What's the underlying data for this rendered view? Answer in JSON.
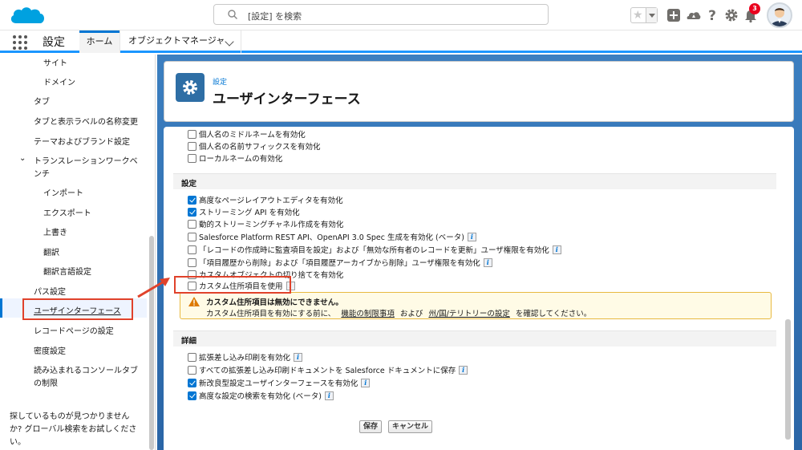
{
  "header": {
    "search_placeholder": "[設定] を検索",
    "notification_count": "3"
  },
  "context_bar": {
    "app_name": "設定",
    "tabs": [
      {
        "label": "ホーム"
      },
      {
        "label": "オブジェクトマネージャ"
      }
    ]
  },
  "sidebar": {
    "items": [
      {
        "label": "サイト"
      },
      {
        "label": "ドメイン"
      },
      {
        "label": "タブ"
      },
      {
        "label": "タブと表示ラベルの名称変更"
      },
      {
        "label": "テーマおよびブランド設定"
      },
      {
        "label": "トランスレーションワークベ"
      },
      {
        "label": "ンチ"
      },
      {
        "label": "インポート"
      },
      {
        "label": "エクスポート"
      },
      {
        "label": "上書き"
      },
      {
        "label": "翻訳"
      },
      {
        "label": "翻訳言語設定"
      },
      {
        "label": "パス設定"
      },
      {
        "label": "ユーザインターフェース"
      },
      {
        "label": "レコードページの設定"
      },
      {
        "label": "密度設定"
      },
      {
        "label": "読み込まれるコンソールタブ"
      },
      {
        "label": "の制限"
      }
    ],
    "help_line1": "探しているものが見つかりません",
    "help_line2": "か? グローバル検索をお試しくださ",
    "help_line3": "い。"
  },
  "page_header": {
    "eyebrow": "設定",
    "title": "ユーザインターフェース"
  },
  "name_rows": [
    {
      "label": "個人名のミドルネームを有効化",
      "checked": false
    },
    {
      "label": "個人名の名前サフィックスを有効化",
      "checked": false
    },
    {
      "label": "ローカルネームの有効化",
      "checked": false
    }
  ],
  "settings_section": {
    "title": "設定",
    "rows": [
      {
        "label": "高度なページレイアウトエディタを有効化",
        "checked": true,
        "info": false
      },
      {
        "label": "ストリーミング API を有効化",
        "checked": true,
        "info": false
      },
      {
        "label": "動的ストリーミングチャネル作成を有効化",
        "checked": false,
        "info": false
      },
      {
        "label": "Salesforce Platform REST API、OpenAPI 3.0 Spec 生成を有効化 (ベータ)",
        "checked": false,
        "info": true
      },
      {
        "label": "「レコードの作成時に監査項目を設定」および「無効な所有者のレコードを更新」ユーザ権限を有効化",
        "checked": false,
        "info": true
      },
      {
        "label": "「項目履歴から削除」および「項目履歴アーカイブから削除」ユーザ権限を有効化",
        "checked": false,
        "info": true
      },
      {
        "label": "カスタムオブジェクトの切り捨てを有効化",
        "checked": false,
        "info": false
      },
      {
        "label": "カスタム住所項目を使用",
        "checked": false,
        "info": true
      }
    ]
  },
  "warning": {
    "title": "カスタム住所項目は無効にできません。",
    "text_before": "カスタム住所項目を有効にする前に、",
    "link1": "機能の制限事項",
    "text_mid": "および",
    "link2": "州/国/テリトリーの設定",
    "text_after": "を確認してください。"
  },
  "details_section": {
    "title": "詳細",
    "rows": [
      {
        "label": "拡張差し込み印刷を有効化",
        "checked": false,
        "info": true
      },
      {
        "label": "すべての拡張差し込み印刷ドキュメントを Salesforce ドキュメントに保存",
        "checked": false,
        "info": true
      },
      {
        "label": "新改良型設定ユーザインターフェースを有効化",
        "checked": true,
        "info": true
      },
      {
        "label": "高度な設定の検索を有効化 (ベータ)",
        "checked": true,
        "info": true
      }
    ]
  },
  "buttons": {
    "save": "保存",
    "cancel": "キャンセル"
  },
  "colors": {
    "brand_blue": "#0176d3",
    "highlight_red": "#e0422b",
    "warning_yellow": "#fffbe6"
  }
}
